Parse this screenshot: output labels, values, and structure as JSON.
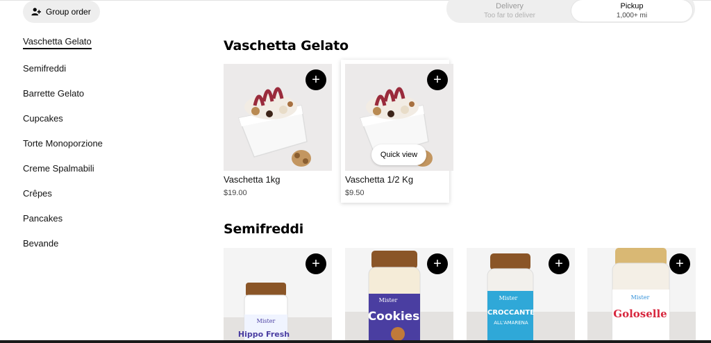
{
  "header": {
    "group_order_label": "Group order",
    "delivery_label": "Delivery",
    "delivery_sub": "Too far to deliver",
    "pickup_label": "Pickup",
    "pickup_sub": "1,000+ mi"
  },
  "sidebar": {
    "items": [
      {
        "label": "Vaschetta Gelato",
        "active": true
      },
      {
        "label": "Semifreddi"
      },
      {
        "label": "Barrette Gelato"
      },
      {
        "label": "Cupcakes"
      },
      {
        "label": "Torte Monoporzione"
      },
      {
        "label": "Creme Spalmabili"
      },
      {
        "label": "Crêpes"
      },
      {
        "label": "Pancakes"
      },
      {
        "label": "Bevande"
      }
    ]
  },
  "sections": [
    {
      "title": "Vaschetta Gelato",
      "items": [
        {
          "name": "Vaschetta 1kg",
          "price": "$19.00",
          "icon": "plus-icon"
        },
        {
          "name": "Vaschetta 1/2 Kg",
          "price": "$9.50",
          "icon": "plus-icon",
          "quick_view": "Quick view"
        }
      ]
    },
    {
      "title": "Semifreddi",
      "items": [
        {
          "jar_text": [
            "Mister",
            "Hippo Fresh"
          ],
          "icon": "plus-icon"
        },
        {
          "jar_text": [
            "Mister",
            "Cookies"
          ],
          "icon": "plus-icon"
        },
        {
          "jar_text": [
            "Mister",
            "CROCCANTE",
            "ALL'AMARENA"
          ],
          "icon": "plus-icon"
        },
        {
          "jar_text": [
            "Mister",
            "Goloselle"
          ],
          "icon": "plus-icon"
        }
      ]
    }
  ],
  "colors": {
    "accent": "#000000",
    "chip_bg": "#eeeeee",
    "jar_label_purple": "#4a3ea1",
    "jar_label_cyan": "#2fa8d8",
    "hazelnut": "#8a5527"
  }
}
